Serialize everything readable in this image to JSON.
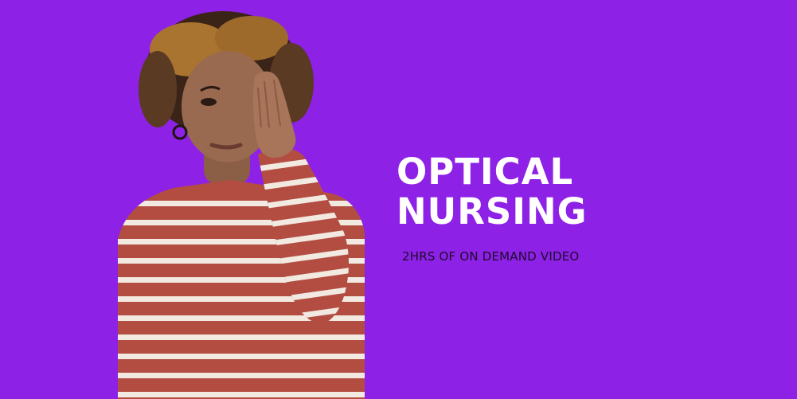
{
  "banner": {
    "background_color": "#8e21e6",
    "title_lines": [
      "OPTICAL",
      "NURSING"
    ],
    "subtitle": "2HRS OF ON DEMAND VIDEO",
    "title_color": "#ffffff",
    "subtitle_color": "#1c0b2a"
  },
  "photo": {
    "subject": "person-covering-one-eye"
  }
}
